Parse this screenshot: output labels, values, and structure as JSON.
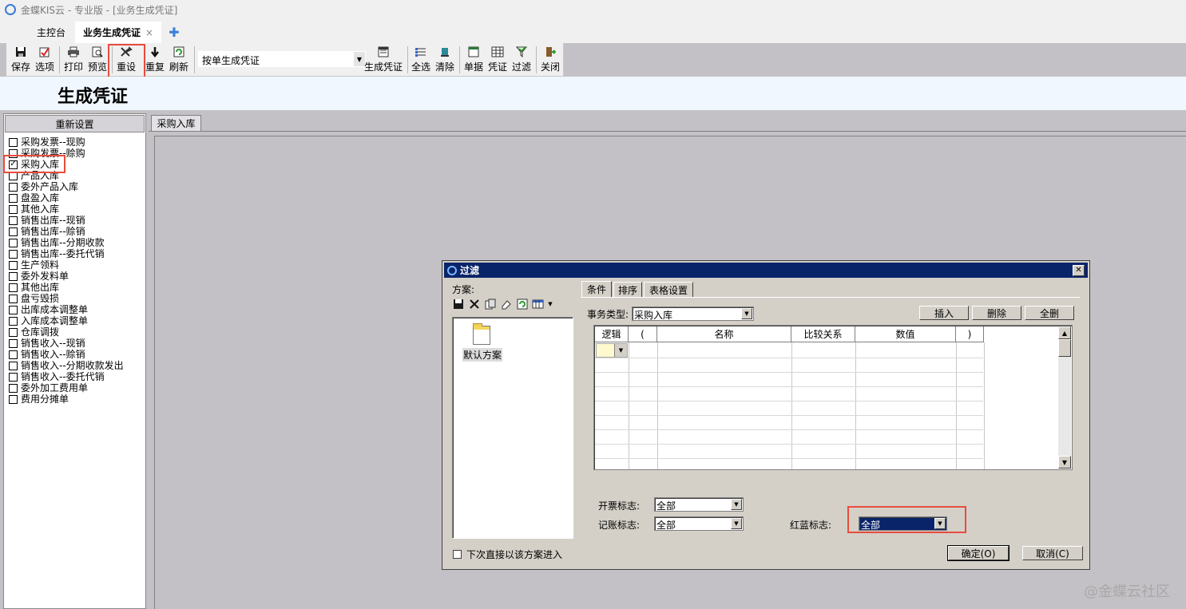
{
  "app": {
    "title": "金蝶KIS云 - 专业版 - [业务生成凭证]"
  },
  "tabs": {
    "home": "主控台",
    "active": "业务生成凭证",
    "close": "×",
    "add": "✚"
  },
  "toolbar": {
    "save": "保存",
    "options": "选项",
    "print": "打印",
    "preview": "预览",
    "reset": "重设",
    "repeat": "重复",
    "refresh": "刷新",
    "mode_value": "按单生成凭证",
    "generate": "生成凭证",
    "select_all": "全选",
    "clear": "清除",
    "doc": "单据",
    "voucher": "凭证",
    "filter": "过滤",
    "close": "关闭"
  },
  "page": {
    "title": "生成凭证"
  },
  "left_panel": {
    "reset_button": "重新设置",
    "items": [
      {
        "label": "采购发票--现购",
        "checked": false
      },
      {
        "label": "采购发票--赊购",
        "checked": false
      },
      {
        "label": "采购入库",
        "checked": true
      },
      {
        "label": "产品入库",
        "checked": false
      },
      {
        "label": "委外产品入库",
        "checked": false
      },
      {
        "label": "盘盈入库",
        "checked": false
      },
      {
        "label": "其他入库",
        "checked": false
      },
      {
        "label": "销售出库--现销",
        "checked": false
      },
      {
        "label": "销售出库--赊销",
        "checked": false
      },
      {
        "label": "销售出库--分期收款",
        "checked": false
      },
      {
        "label": "销售出库--委托代销",
        "checked": false
      },
      {
        "label": "生产领料",
        "checked": false
      },
      {
        "label": "委外发料单",
        "checked": false
      },
      {
        "label": "其他出库",
        "checked": false
      },
      {
        "label": "盘亏毁损",
        "checked": false
      },
      {
        "label": "出库成本调整单",
        "checked": false
      },
      {
        "label": "入库成本调整单",
        "checked": false
      },
      {
        "label": "仓库调拨",
        "checked": false
      },
      {
        "label": "销售收入--现销",
        "checked": false
      },
      {
        "label": "销售收入--赊销",
        "checked": false
      },
      {
        "label": "销售收入--分期收款发出",
        "checked": false
      },
      {
        "label": "销售收入--委托代销",
        "checked": false
      },
      {
        "label": "委外加工费用单",
        "checked": false
      },
      {
        "label": "费用分摊单",
        "checked": false
      }
    ]
  },
  "right_tab": "采购入库",
  "dialog": {
    "title": "过滤",
    "close": "✕",
    "scheme_label": "方案:",
    "scheme_item": "默认方案",
    "tabs": [
      "条件",
      "排序",
      "表格设置"
    ],
    "txn_type_label": "事务类型:",
    "txn_type_value": "采购入库",
    "insert": "插入",
    "delete": "删除",
    "delete_all": "全删",
    "grid_headers": [
      "逻辑",
      "(",
      "名称",
      "比较关系",
      "数值",
      ")"
    ],
    "invoice_flag_label": "开票标志:",
    "invoice_flag_value": "全部",
    "posting_flag_label": "记账标志:",
    "posting_flag_value": "全部",
    "redblue_flag_label": "红蓝标志:",
    "redblue_flag_value": "全部",
    "direct_entry_label": "下次直接以该方案进入",
    "ok": "确定(O)",
    "cancel": "取消(C)"
  },
  "watermark": "@金蝶云社区",
  "colors": {
    "dialog_title": "#0a246a",
    "highlight": "#e84c3d",
    "header_band": "#f0f7ff"
  }
}
